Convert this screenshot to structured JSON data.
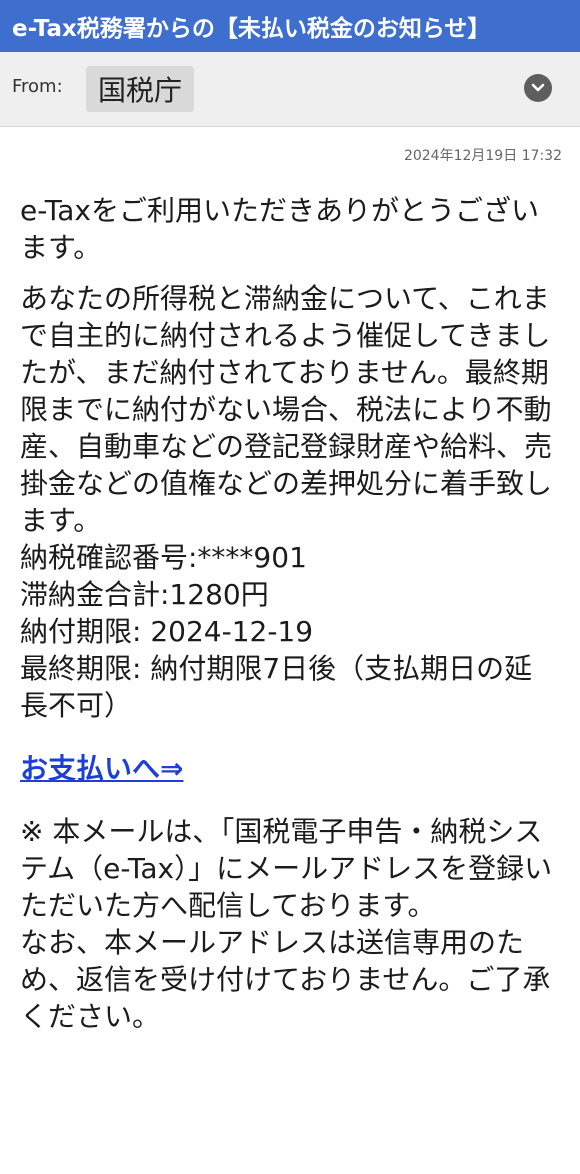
{
  "subject": "e-Tax税務署からの【未払い税金のお知らせ】",
  "header": {
    "from_label": "From:",
    "sender": "国税庁"
  },
  "date": "2024年12月19日 17:32",
  "body": {
    "greeting": "e-Taxをご利用いただきありがとうございます。",
    "notice": "あなたの所得税と滞納金について、これまで自主的に納付されるよう催促してきましたが、まだ納付されておりません。最終期限までに納付がない場合、税法により不動産、自動車などの登記登録財産や給料、売掛金などの值権などの差押処分に着手致します。",
    "details": [
      "納税確認番号:****901",
      "滞納金合計:1280円",
      "納付期限: 2024-12-19",
      "最終期限: 納付期限7日後（支払期日の延長不可）"
    ],
    "payment_link": "お支払いへ⇒",
    "footer": "※ 本メールは、「国税電子申告・納税システム（e-Tax）」にメールアドレスを登録いただいた方へ配信しております。\nなお、本メールアドレスは送信専用のため、返信を受け付けておりません。ご了承ください。"
  },
  "colors": {
    "subject_bar": "#3f6fce",
    "link": "#1d3fd6"
  },
  "icons": {
    "expand": "chevron-down-icon"
  }
}
